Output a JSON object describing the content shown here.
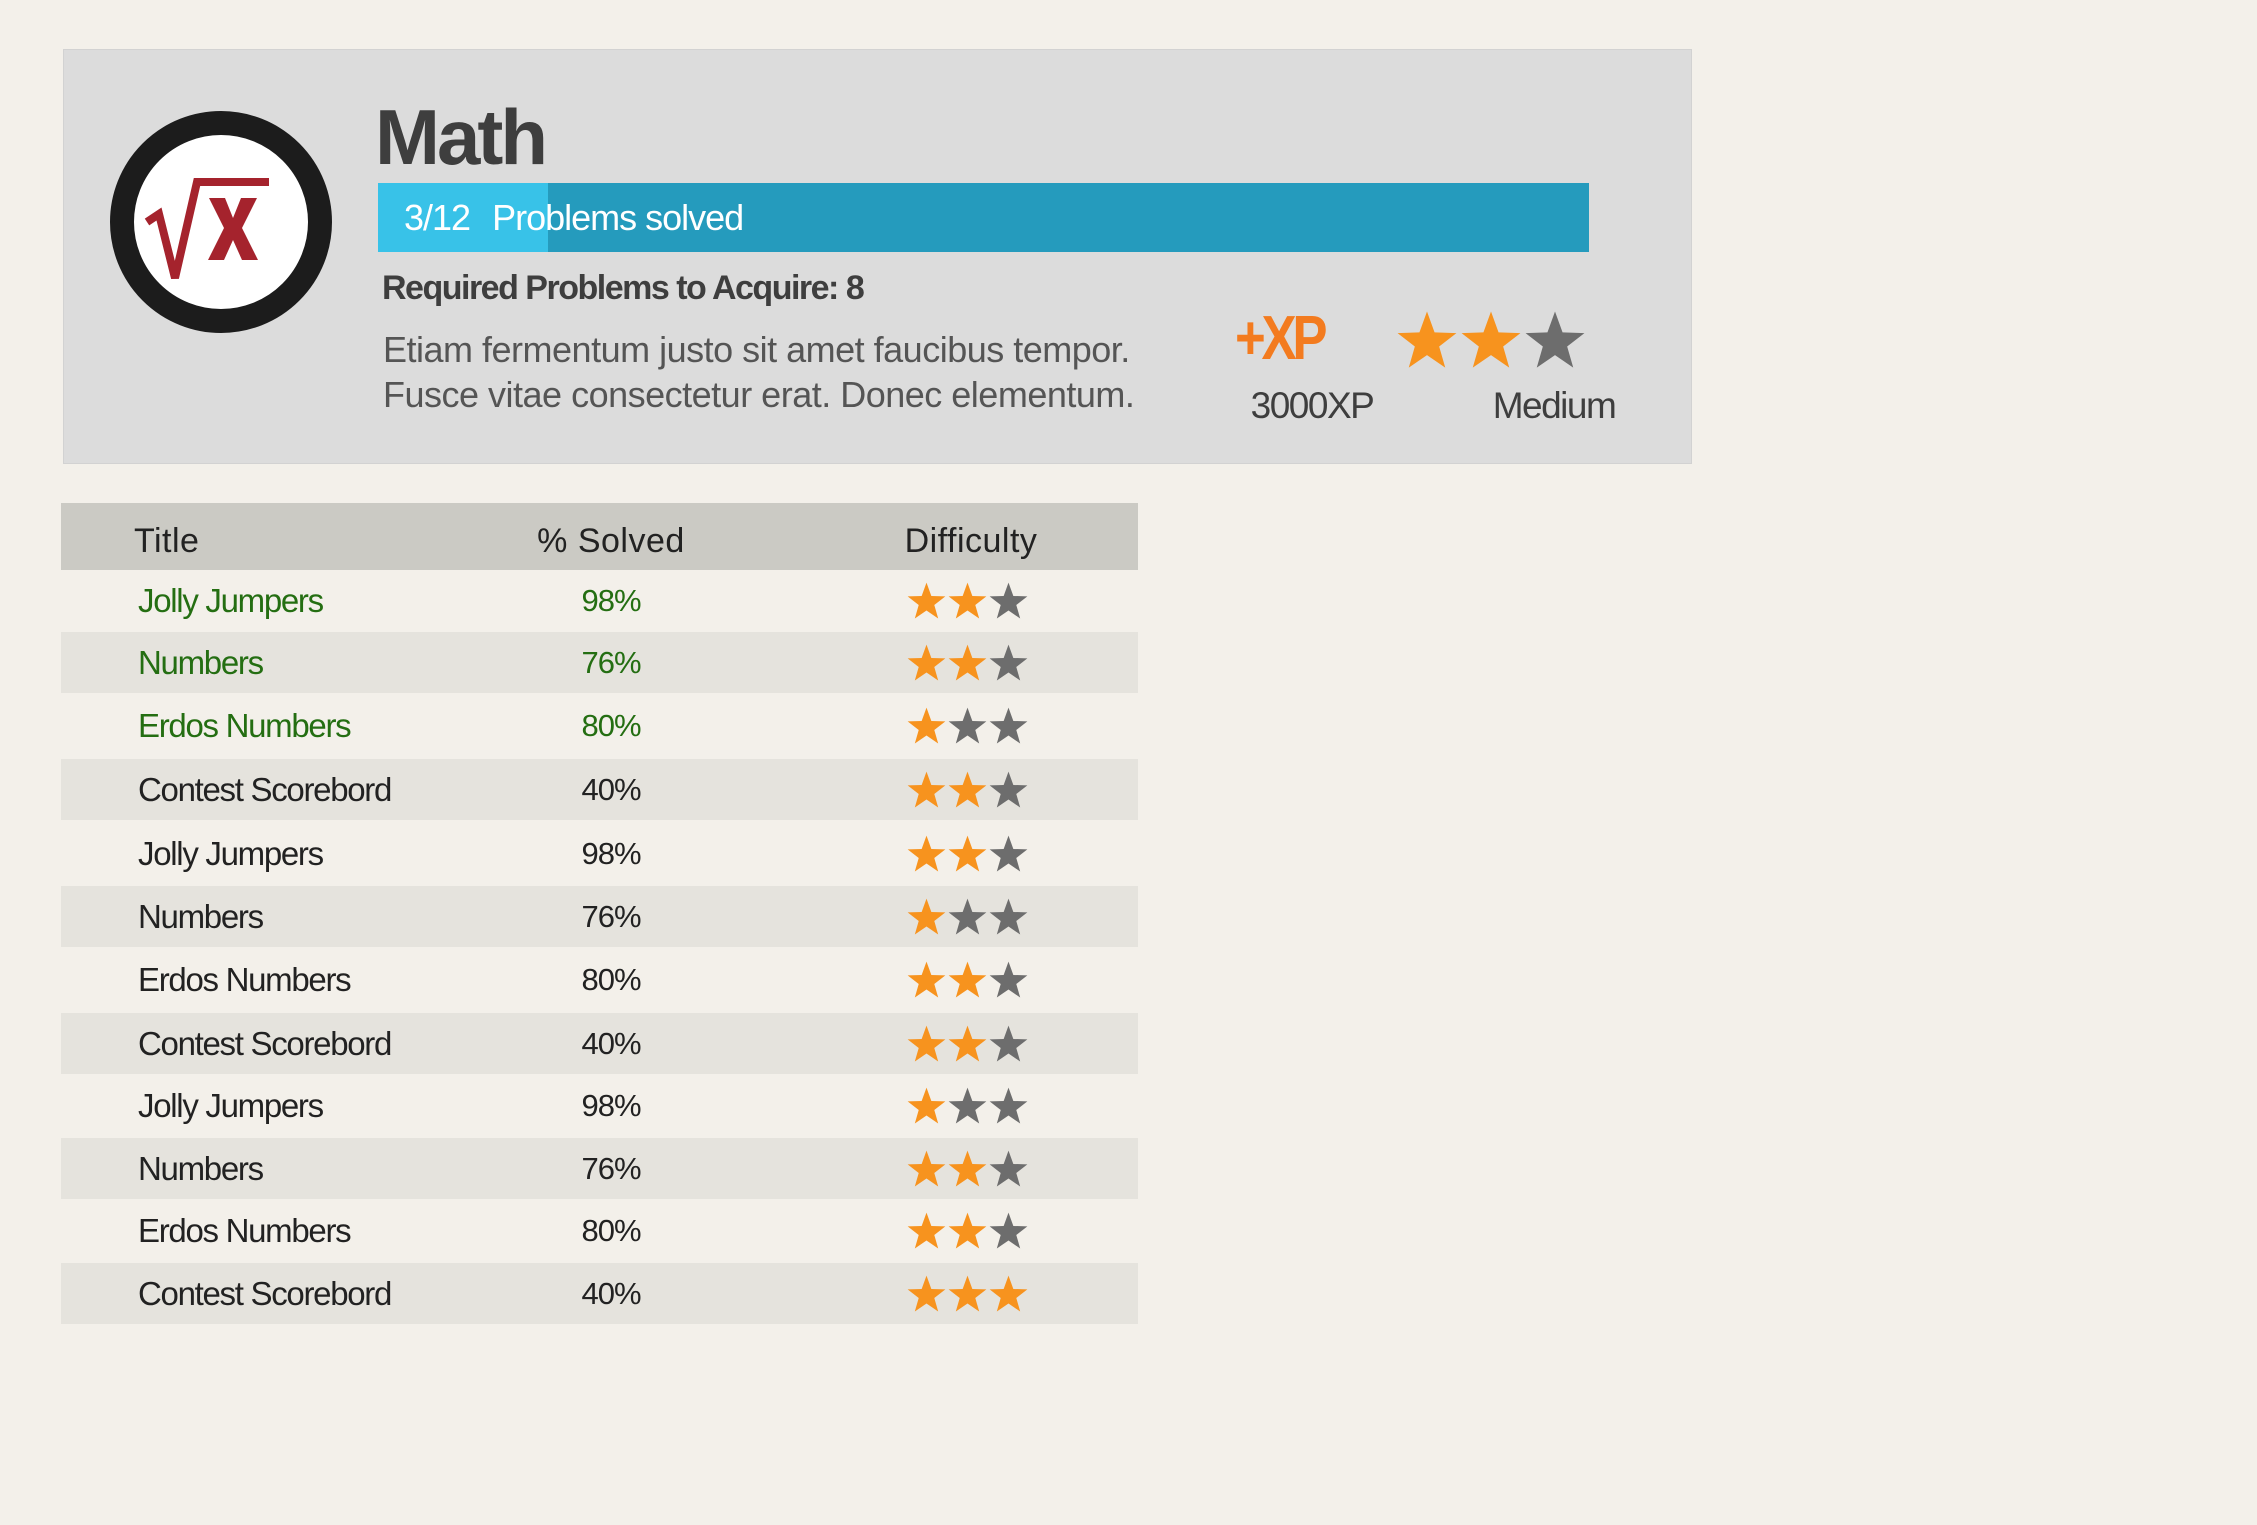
{
  "colors": {
    "star_filled": "#f7931e",
    "star_empty": "#6d6d6d",
    "solved_green": "#246e12",
    "progress_bg": "#259bbd",
    "progress_fill": "#38c2e8",
    "xp_orange": "#f37b1f",
    "logo_red": "#a5232d"
  },
  "topic": {
    "icon": "square-root-x-icon",
    "title": "Math",
    "progress": {
      "count": "3/12",
      "label": "Problems solved",
      "fraction": 0.14
    },
    "required_label": "Required Problems to Acquire: 8",
    "description": [
      "Etiam fermentum justo sit amet faucibus tempor.",
      "Fusce vitae consectetur erat. Donec elementum."
    ],
    "xp": {
      "icon_text": "+XP",
      "label": "3000XP"
    },
    "difficulty": {
      "stars": 2,
      "max": 3,
      "label": "Medium"
    }
  },
  "table": {
    "headers": {
      "title": "Title",
      "solved": "% Solved",
      "difficulty": "Difficulty"
    },
    "rows": [
      {
        "title": "Jolly Jumpers",
        "solved": "98%",
        "stars": 2,
        "completed": true
      },
      {
        "title": "Numbers",
        "solved": "76%",
        "stars": 2,
        "completed": true
      },
      {
        "title": "Erdos Numbers",
        "solved": "80%",
        "stars": 1,
        "completed": true
      },
      {
        "title": "Contest Scorebord",
        "solved": "40%",
        "stars": 2,
        "completed": false
      },
      {
        "title": "Jolly Jumpers",
        "solved": "98%",
        "stars": 2,
        "completed": false
      },
      {
        "title": "Numbers",
        "solved": "76%",
        "stars": 1,
        "completed": false
      },
      {
        "title": "Erdos Numbers",
        "solved": "80%",
        "stars": 2,
        "completed": false
      },
      {
        "title": "Contest Scorebord",
        "solved": "40%",
        "stars": 2,
        "completed": false
      },
      {
        "title": "Jolly Jumpers",
        "solved": "98%",
        "stars": 1,
        "completed": false
      },
      {
        "title": "Numbers",
        "solved": "76%",
        "stars": 2,
        "completed": false
      },
      {
        "title": "Erdos Numbers",
        "solved": "80%",
        "stars": 2,
        "completed": false
      },
      {
        "title": "Contest Scorebord",
        "solved": "40%",
        "stars": 3,
        "completed": false
      }
    ]
  }
}
